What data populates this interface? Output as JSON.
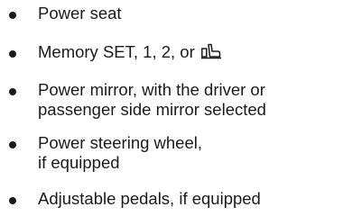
{
  "list": {
    "items": [
      {
        "lines": [
          "Power seat"
        ]
      },
      {
        "lines": [
          "Memory SET, 1, 2, or "
        ],
        "trailing_icon": "driver-seat-icon"
      },
      {
        "lines": [
          "Power mirror, with the driver or",
          "passenger side mirror selected"
        ]
      },
      {
        "lines": [
          "Power steering wheel,",
          "if equipped"
        ]
      },
      {
        "lines": [
          "Adjustable pedals, if equipped"
        ]
      }
    ]
  }
}
